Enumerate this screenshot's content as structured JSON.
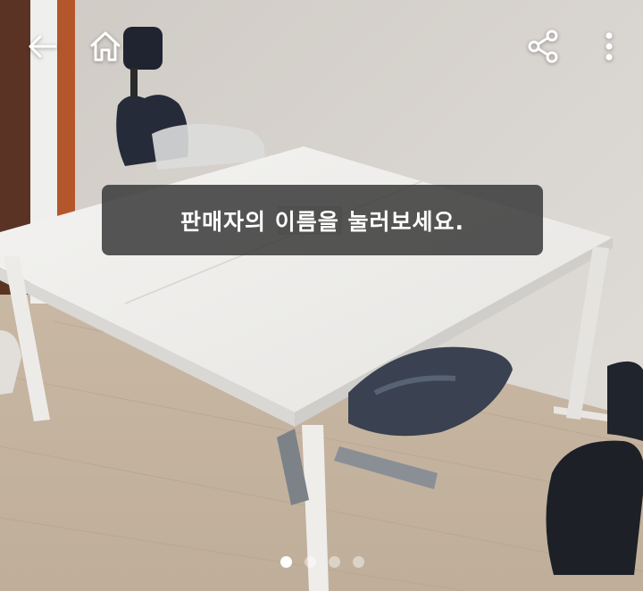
{
  "tooltip": {
    "text": "판매자의 이름을 눌러보세요."
  },
  "pagination": {
    "total": 4,
    "current": 1
  },
  "icons": {
    "back": "back-arrow-icon",
    "home": "home-icon",
    "share": "share-icon",
    "more": "more-vert-icon"
  },
  "colors": {
    "overlay": "#3a3a3a",
    "icon": "#ffffff",
    "dot_active": "#ffffff",
    "dot_inactive": "#bdbdbd"
  }
}
